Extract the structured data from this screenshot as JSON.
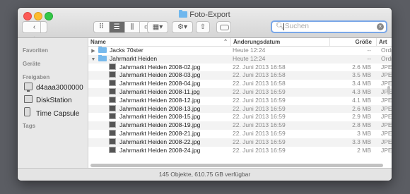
{
  "window": {
    "title": "Foto-Export"
  },
  "toolbar": {
    "back_glyph": "‹",
    "forward_glyph": "›",
    "view_icons": [
      "icon-view-icon",
      "list-view-icon",
      "column-view-icon",
      "cover-flow-icon"
    ],
    "arrange_glyph": "▦▾",
    "action_glyph": "⚙▾",
    "share_glyph": "⇧"
  },
  "search": {
    "placeholder": "Suchen",
    "value": ""
  },
  "sidebar": {
    "sections": [
      {
        "label": "Favoriten",
        "items": []
      },
      {
        "label": "Geräte",
        "items": []
      },
      {
        "label": "Freigaben",
        "items": [
          {
            "label": "d4aaa3000000",
            "icon": "monitor-icon"
          },
          {
            "label": "DiskStation",
            "icon": "server-icon"
          },
          {
            "label": "Time Capsule",
            "icon": "time-capsule-icon"
          }
        ]
      },
      {
        "label": "Tags",
        "items": []
      }
    ]
  },
  "columns": {
    "name": "Name",
    "date": "Änderungsdatum",
    "size": "Größe",
    "kind": "Art"
  },
  "rows": [
    {
      "name": "Jacks 70ster",
      "type": "folder",
      "expanded": false,
      "date": "Heute 12:24",
      "size": "--",
      "kind": "Ordner"
    },
    {
      "name": "Jahrmarkt Heiden",
      "type": "folder",
      "expanded": true,
      "date": "Heute 12:24",
      "size": "--",
      "kind": "Ordner"
    },
    {
      "name": "Jahrmarkt Heiden 2008-02.jpg",
      "type": "file",
      "date": "22. Juni 2013 16:58",
      "size": "2.6 MB",
      "kind": "JPEG-E"
    },
    {
      "name": "Jahrmarkt Heiden 2008-03.jpg",
      "type": "file",
      "date": "22. Juni 2013 16:58",
      "size": "3.5 MB",
      "kind": "JPEG-E"
    },
    {
      "name": "Jahrmarkt Heiden 2008-04.jpg",
      "type": "file",
      "date": "22. Juni 2013 16:58",
      "size": "3.4 MB",
      "kind": "JPEG-E"
    },
    {
      "name": "Jahrmarkt Heiden 2008-11.jpg",
      "type": "file",
      "date": "22. Juni 2013 16:59",
      "size": "4.3 MB",
      "kind": "JPEG-E"
    },
    {
      "name": "Jahrmarkt Heiden 2008-12.jpg",
      "type": "file",
      "date": "22. Juni 2013 16:59",
      "size": "4.1 MB",
      "kind": "JPEG-E"
    },
    {
      "name": "Jahrmarkt Heiden 2008-13.jpg",
      "type": "file",
      "date": "22. Juni 2013 16:59",
      "size": "2.6 MB",
      "kind": "JPEG-E"
    },
    {
      "name": "Jahrmarkt Heiden 2008-15.jpg",
      "type": "file",
      "date": "22. Juni 2013 16:59",
      "size": "2.9 MB",
      "kind": "JPEG-E"
    },
    {
      "name": "Jahrmarkt Heiden 2008-19.jpg",
      "type": "file",
      "date": "22. Juni 2013 16:59",
      "size": "2.8 MB",
      "kind": "JPEG-E"
    },
    {
      "name": "Jahrmarkt Heiden 2008-21.jpg",
      "type": "file",
      "date": "22. Juni 2013 16:59",
      "size": "3 MB",
      "kind": "JPEG-E"
    },
    {
      "name": "Jahrmarkt Heiden 2008-22.jpg",
      "type": "file",
      "date": "22. Juni 2013 16:59",
      "size": "3.3 MB",
      "kind": "JPEG-E"
    },
    {
      "name": "Jahrmarkt Heiden 2008-24.jpg",
      "type": "file",
      "date": "22. Juni 2013 16:59",
      "size": "2 MB",
      "kind": "JPEG-E"
    }
  ],
  "status": {
    "text": "145 Objekte, 610.75 GB verfügbar"
  }
}
